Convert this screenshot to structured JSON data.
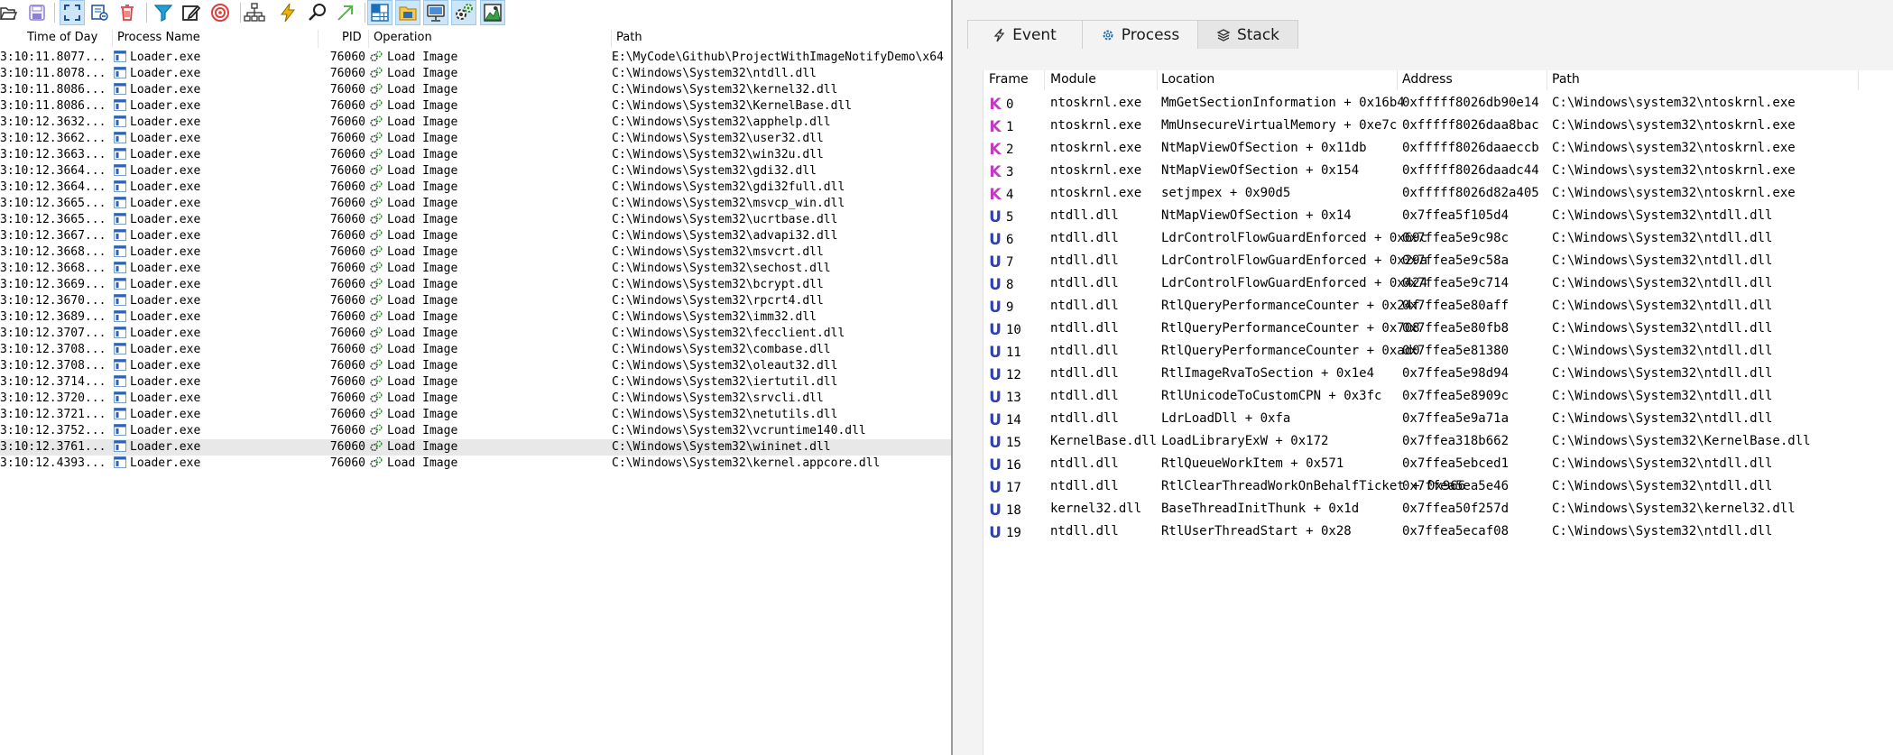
{
  "toolbar": {
    "icons": [
      "open-icon",
      "save-icon",
      "autoscroll-icon",
      "clear-icon",
      "delete-icon",
      "filter-icon",
      "highlight-icon",
      "target-icon",
      "process-tree-icon",
      "event-icon",
      "find-icon",
      "jump-icon",
      "registry-icon",
      "filesystem-icon",
      "network-icon",
      "process-activity-icon",
      "profiling-icon"
    ]
  },
  "event_list": {
    "columns": {
      "time": "Time of Day",
      "process": "Process Name",
      "pid": "PID",
      "operation": "Operation",
      "path": "Path"
    },
    "rows": [
      {
        "time": "3:10:11.8077...",
        "process": "Loader.exe",
        "pid": "76060",
        "operation": "Load Image",
        "path": "E:\\MyCode\\Github\\ProjectWithImageNotifyDemo\\x64"
      },
      {
        "time": "3:10:11.8078...",
        "process": "Loader.exe",
        "pid": "76060",
        "operation": "Load Image",
        "path": "C:\\Windows\\System32\\ntdll.dll"
      },
      {
        "time": "3:10:11.8086...",
        "process": "Loader.exe",
        "pid": "76060",
        "operation": "Load Image",
        "path": "C:\\Windows\\System32\\kernel32.dll"
      },
      {
        "time": "3:10:11.8086...",
        "process": "Loader.exe",
        "pid": "76060",
        "operation": "Load Image",
        "path": "C:\\Windows\\System32\\KernelBase.dll"
      },
      {
        "time": "3:10:12.3632...",
        "process": "Loader.exe",
        "pid": "76060",
        "operation": "Load Image",
        "path": "C:\\Windows\\System32\\apphelp.dll"
      },
      {
        "time": "3:10:12.3662...",
        "process": "Loader.exe",
        "pid": "76060",
        "operation": "Load Image",
        "path": "C:\\Windows\\System32\\user32.dll"
      },
      {
        "time": "3:10:12.3663...",
        "process": "Loader.exe",
        "pid": "76060",
        "operation": "Load Image",
        "path": "C:\\Windows\\System32\\win32u.dll"
      },
      {
        "time": "3:10:12.3664...",
        "process": "Loader.exe",
        "pid": "76060",
        "operation": "Load Image",
        "path": "C:\\Windows\\System32\\gdi32.dll"
      },
      {
        "time": "3:10:12.3664...",
        "process": "Loader.exe",
        "pid": "76060",
        "operation": "Load Image",
        "path": "C:\\Windows\\System32\\gdi32full.dll"
      },
      {
        "time": "3:10:12.3665...",
        "process": "Loader.exe",
        "pid": "76060",
        "operation": "Load Image",
        "path": "C:\\Windows\\System32\\msvcp_win.dll"
      },
      {
        "time": "3:10:12.3665...",
        "process": "Loader.exe",
        "pid": "76060",
        "operation": "Load Image",
        "path": "C:\\Windows\\System32\\ucrtbase.dll"
      },
      {
        "time": "3:10:12.3667...",
        "process": "Loader.exe",
        "pid": "76060",
        "operation": "Load Image",
        "path": "C:\\Windows\\System32\\advapi32.dll"
      },
      {
        "time": "3:10:12.3668...",
        "process": "Loader.exe",
        "pid": "76060",
        "operation": "Load Image",
        "path": "C:\\Windows\\System32\\msvcrt.dll"
      },
      {
        "time": "3:10:12.3668...",
        "process": "Loader.exe",
        "pid": "76060",
        "operation": "Load Image",
        "path": "C:\\Windows\\System32\\sechost.dll"
      },
      {
        "time": "3:10:12.3669...",
        "process": "Loader.exe",
        "pid": "76060",
        "operation": "Load Image",
        "path": "C:\\Windows\\System32\\bcrypt.dll"
      },
      {
        "time": "3:10:12.3670...",
        "process": "Loader.exe",
        "pid": "76060",
        "operation": "Load Image",
        "path": "C:\\Windows\\System32\\rpcrt4.dll"
      },
      {
        "time": "3:10:12.3689...",
        "process": "Loader.exe",
        "pid": "76060",
        "operation": "Load Image",
        "path": "C:\\Windows\\System32\\imm32.dll"
      },
      {
        "time": "3:10:12.3707...",
        "process": "Loader.exe",
        "pid": "76060",
        "operation": "Load Image",
        "path": "C:\\Windows\\System32\\fecclient.dll"
      },
      {
        "time": "3:10:12.3708...",
        "process": "Loader.exe",
        "pid": "76060",
        "operation": "Load Image",
        "path": "C:\\Windows\\System32\\combase.dll"
      },
      {
        "time": "3:10:12.3708...",
        "process": "Loader.exe",
        "pid": "76060",
        "operation": "Load Image",
        "path": "C:\\Windows\\System32\\oleaut32.dll"
      },
      {
        "time": "3:10:12.3714...",
        "process": "Loader.exe",
        "pid": "76060",
        "operation": "Load Image",
        "path": "C:\\Windows\\System32\\iertutil.dll"
      },
      {
        "time": "3:10:12.3720...",
        "process": "Loader.exe",
        "pid": "76060",
        "operation": "Load Image",
        "path": "C:\\Windows\\System32\\srvcli.dll"
      },
      {
        "time": "3:10:12.3721...",
        "process": "Loader.exe",
        "pid": "76060",
        "operation": "Load Image",
        "path": "C:\\Windows\\System32\\netutils.dll"
      },
      {
        "time": "3:10:12.3752...",
        "process": "Loader.exe",
        "pid": "76060",
        "operation": "Load Image",
        "path": "C:\\Windows\\System32\\vcruntime140.dll"
      },
      {
        "time": "3:10:12.3761...",
        "process": "Loader.exe",
        "pid": "76060",
        "operation": "Load Image",
        "path": "C:\\Windows\\System32\\wininet.dll"
      },
      {
        "time": "3:10:12.4393...",
        "process": "Loader.exe",
        "pid": "76060",
        "operation": "Load Image",
        "path": "C:\\Windows\\System32\\kernel.appcore.dll"
      }
    ],
    "selected_row": 24
  },
  "tabs": [
    {
      "label": "Event",
      "icon": "lightning-icon"
    },
    {
      "label": "Process",
      "icon": "gear-icon"
    },
    {
      "label": "Stack",
      "icon": "layers-icon"
    }
  ],
  "active_tab": 2,
  "stack": {
    "columns": {
      "frame": "Frame",
      "module": "Module",
      "location": "Location",
      "address": "Address",
      "path": "Path"
    },
    "frames": [
      {
        "mode": "K",
        "frame": "0",
        "module": "ntoskrnl.exe",
        "location": "MmGetSectionInformation + 0x16b4",
        "address": "0xfffff8026db90e14",
        "path": "C:\\Windows\\system32\\ntoskrnl.exe"
      },
      {
        "mode": "K",
        "frame": "1",
        "module": "ntoskrnl.exe",
        "location": "MmUnsecureVirtualMemory + 0xe7c",
        "address": "0xfffff8026daa8bac",
        "path": "C:\\Windows\\system32\\ntoskrnl.exe"
      },
      {
        "mode": "K",
        "frame": "2",
        "module": "ntoskrnl.exe",
        "location": "NtMapViewOfSection + 0x11db",
        "address": "0xfffff8026daaeccb",
        "path": "C:\\Windows\\system32\\ntoskrnl.exe"
      },
      {
        "mode": "K",
        "frame": "3",
        "module": "ntoskrnl.exe",
        "location": "NtMapViewOfSection + 0x154",
        "address": "0xfffff8026daadc44",
        "path": "C:\\Windows\\system32\\ntoskrnl.exe"
      },
      {
        "mode": "K",
        "frame": "4",
        "module": "ntoskrnl.exe",
        "location": "setjmpex + 0x90d5",
        "address": "0xfffff8026d82a405",
        "path": "C:\\Windows\\system32\\ntoskrnl.exe"
      },
      {
        "mode": "U",
        "frame": "5",
        "module": "ntdll.dll",
        "location": "NtMapViewOfSection + 0x14",
        "address": "0x7ffea5f105d4",
        "path": "C:\\Windows\\System32\\ntdll.dll"
      },
      {
        "mode": "U",
        "frame": "6",
        "module": "ntdll.dll",
        "location": "LdrControlFlowGuardEnforced + 0x69c",
        "address": "0x7ffea5e9c98c",
        "path": "C:\\Windows\\System32\\ntdll.dll"
      },
      {
        "mode": "U",
        "frame": "7",
        "module": "ntdll.dll",
        "location": "LdrControlFlowGuardEnforced + 0x29a",
        "address": "0x7ffea5e9c58a",
        "path": "C:\\Windows\\System32\\ntdll.dll"
      },
      {
        "mode": "U",
        "frame": "8",
        "module": "ntdll.dll",
        "location": "LdrControlFlowGuardEnforced + 0x424",
        "address": "0x7ffea5e9c714",
        "path": "C:\\Windows\\System32\\ntdll.dll"
      },
      {
        "mode": "U",
        "frame": "9",
        "module": "ntdll.dll",
        "location": "RtlQueryPerformanceCounter + 0x24f",
        "address": "0x7ffea5e80aff",
        "path": "C:\\Windows\\System32\\ntdll.dll"
      },
      {
        "mode": "U",
        "frame": "10",
        "module": "ntdll.dll",
        "location": "RtlQueryPerformanceCounter + 0x708",
        "address": "0x7ffea5e80fb8",
        "path": "C:\\Windows\\System32\\ntdll.dll"
      },
      {
        "mode": "U",
        "frame": "11",
        "module": "ntdll.dll",
        "location": "RtlQueryPerformanceCounter + 0xad0",
        "address": "0x7ffea5e81380",
        "path": "C:\\Windows\\System32\\ntdll.dll"
      },
      {
        "mode": "U",
        "frame": "12",
        "module": "ntdll.dll",
        "location": "RtlImageRvaToSection + 0x1e4",
        "address": "0x7ffea5e98d94",
        "path": "C:\\Windows\\System32\\ntdll.dll"
      },
      {
        "mode": "U",
        "frame": "13",
        "module": "ntdll.dll",
        "location": "RtlUnicodeToCustomCPN + 0x3fc",
        "address": "0x7ffea5e8909c",
        "path": "C:\\Windows\\System32\\ntdll.dll"
      },
      {
        "mode": "U",
        "frame": "14",
        "module": "ntdll.dll",
        "location": "LdrLoadDll + 0xfa",
        "address": "0x7ffea5e9a71a",
        "path": "C:\\Windows\\System32\\ntdll.dll"
      },
      {
        "mode": "U",
        "frame": "15",
        "module": "KernelBase.dll",
        "location": "LoadLibraryExW + 0x172",
        "address": "0x7ffea318b662",
        "path": "C:\\Windows\\System32\\KernelBase.dll"
      },
      {
        "mode": "U",
        "frame": "16",
        "module": "ntdll.dll",
        "location": "RtlQueueWorkItem + 0x571",
        "address": "0x7ffea5ebced1",
        "path": "C:\\Windows\\System32\\ntdll.dll"
      },
      {
        "mode": "U",
        "frame": "17",
        "module": "ntdll.dll",
        "location": "RtlClearThreadWorkOnBehalfTicket + 0x966",
        "address": "0x7ffea5ea5e46",
        "path": "C:\\Windows\\System32\\ntdll.dll"
      },
      {
        "mode": "U",
        "frame": "18",
        "module": "kernel32.dll",
        "location": "BaseThreadInitThunk + 0x1d",
        "address": "0x7ffea50f257d",
        "path": "C:\\Windows\\System32\\kernel32.dll"
      },
      {
        "mode": "U",
        "frame": "19",
        "module": "ntdll.dll",
        "location": "RtlUserThreadStart + 0x28",
        "address": "0x7ffea5ecaf08",
        "path": "C:\\Windows\\System32\\ntdll.dll"
      }
    ]
  },
  "colors": {
    "kernel_mode": "#c03cc0",
    "user_mode": "#2f3fb5",
    "selection": "#e8e8e8",
    "active_tool": "#cde6f7"
  }
}
